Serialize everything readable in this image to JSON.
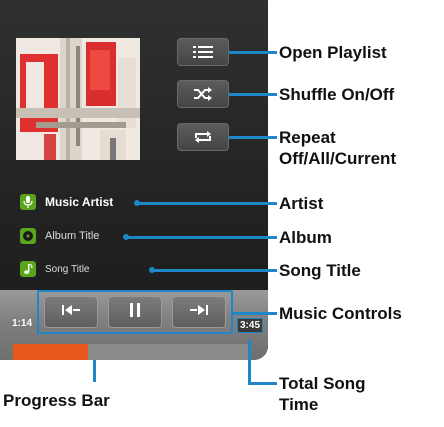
{
  "player": {
    "artist": "Music Artist",
    "album": "Album Title",
    "song": "Song Title",
    "elapsed_time": "1:14",
    "total_time": "3:45",
    "progress_fraction": 0.32
  },
  "icons": {
    "playlist": "playlist-icon",
    "shuffle": "shuffle-icon",
    "repeat": "repeat-icon",
    "artist": "microphone-icon",
    "album": "disc-icon",
    "song": "music-note-icon",
    "previous": "previous-track-icon",
    "pause": "pause-icon",
    "next": "next-track-icon"
  },
  "callouts": {
    "open_playlist": "Open Playlist",
    "shuffle": "Shuffle On/Off",
    "repeat_line1": "Repeat",
    "repeat_line2": "Off/All/Current",
    "artist": "Artist",
    "album": "Album",
    "song_title": "Song Title",
    "music_controls": "Music Controls",
    "progress_bar": "Progress Bar",
    "total_song_line1": "Total Song",
    "total_song_line2": "Time"
  },
  "colors": {
    "accent_blue": "#1f86c8",
    "progress_orange": "#e8571c",
    "icon_green": "#5aa51c"
  }
}
